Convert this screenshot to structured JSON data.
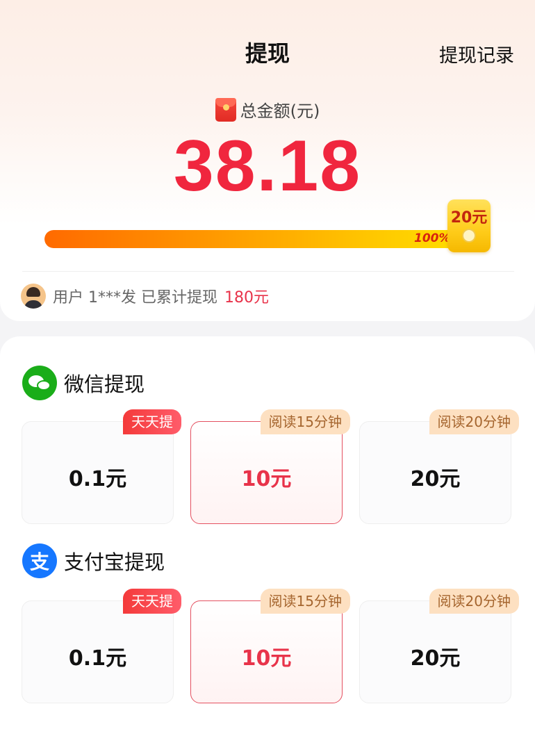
{
  "header": {
    "title": "提现",
    "records_link": "提现记录"
  },
  "balance": {
    "label": "总金额(元)",
    "amount": "38.18",
    "progress_fraction": 1.0,
    "progress_label": "100%",
    "goal_label": "20元"
  },
  "user_stat": {
    "prefix": "用户 1***发 已累计提现",
    "amount": "180元"
  },
  "wechat": {
    "title": "微信提现",
    "options": [
      {
        "amount": "0.1元",
        "tag": "天天提",
        "tag_style": "red",
        "selected": false
      },
      {
        "amount": "10元",
        "tag": "阅读15分钟",
        "tag_style": "peach",
        "selected": true
      },
      {
        "amount": "20元",
        "tag": "阅读20分钟",
        "tag_style": "peach",
        "selected": false
      }
    ]
  },
  "alipay": {
    "title": "支付宝提现",
    "icon_glyph": "支",
    "options": [
      {
        "amount": "0.1元",
        "tag": "天天提",
        "tag_style": "red",
        "selected": false
      },
      {
        "amount": "10元",
        "tag": "阅读15分钟",
        "tag_style": "peach",
        "selected": true
      },
      {
        "amount": "20元",
        "tag": "阅读20分钟",
        "tag_style": "peach",
        "selected": false
      }
    ]
  },
  "colors": {
    "accent_red": "#f0263e",
    "wechat_green": "#1aad19",
    "alipay_blue": "#1677ff"
  }
}
